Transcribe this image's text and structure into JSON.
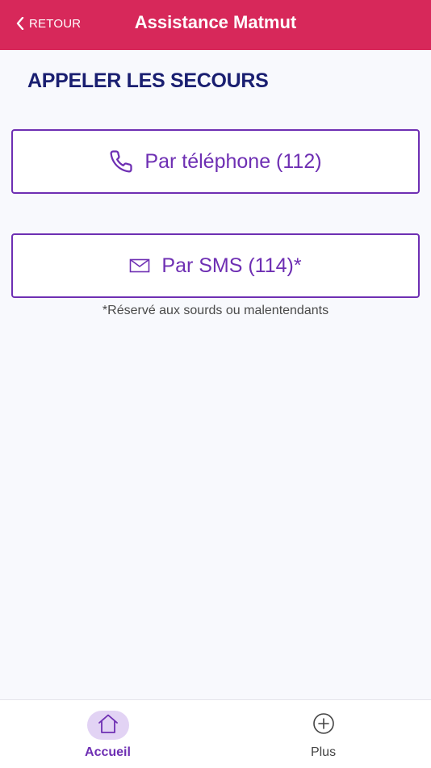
{
  "header": {
    "back_label": "RETOUR",
    "title": "Assistance Matmut",
    "icons": {
      "back": "chevron-left-icon"
    }
  },
  "main": {
    "section_title": "APPELER LES SECOURS",
    "phone_button": {
      "label": "Par téléphone (112)",
      "icon": "phone-icon"
    },
    "sms_button": {
      "label": "Par SMS (114)*",
      "icon": "envelope-icon"
    },
    "footnote": "*Réservé aux sourds ou malentendants"
  },
  "tabbar": {
    "tabs": [
      {
        "label": "Accueil",
        "icon": "home-icon",
        "active": true
      },
      {
        "label": "Plus",
        "icon": "plus-circle-icon",
        "active": false
      }
    ]
  },
  "colors": {
    "header_bg": "#d7285a",
    "accent": "#6e2fb3",
    "title": "#1a1f71",
    "background": "#f8f9fd"
  }
}
